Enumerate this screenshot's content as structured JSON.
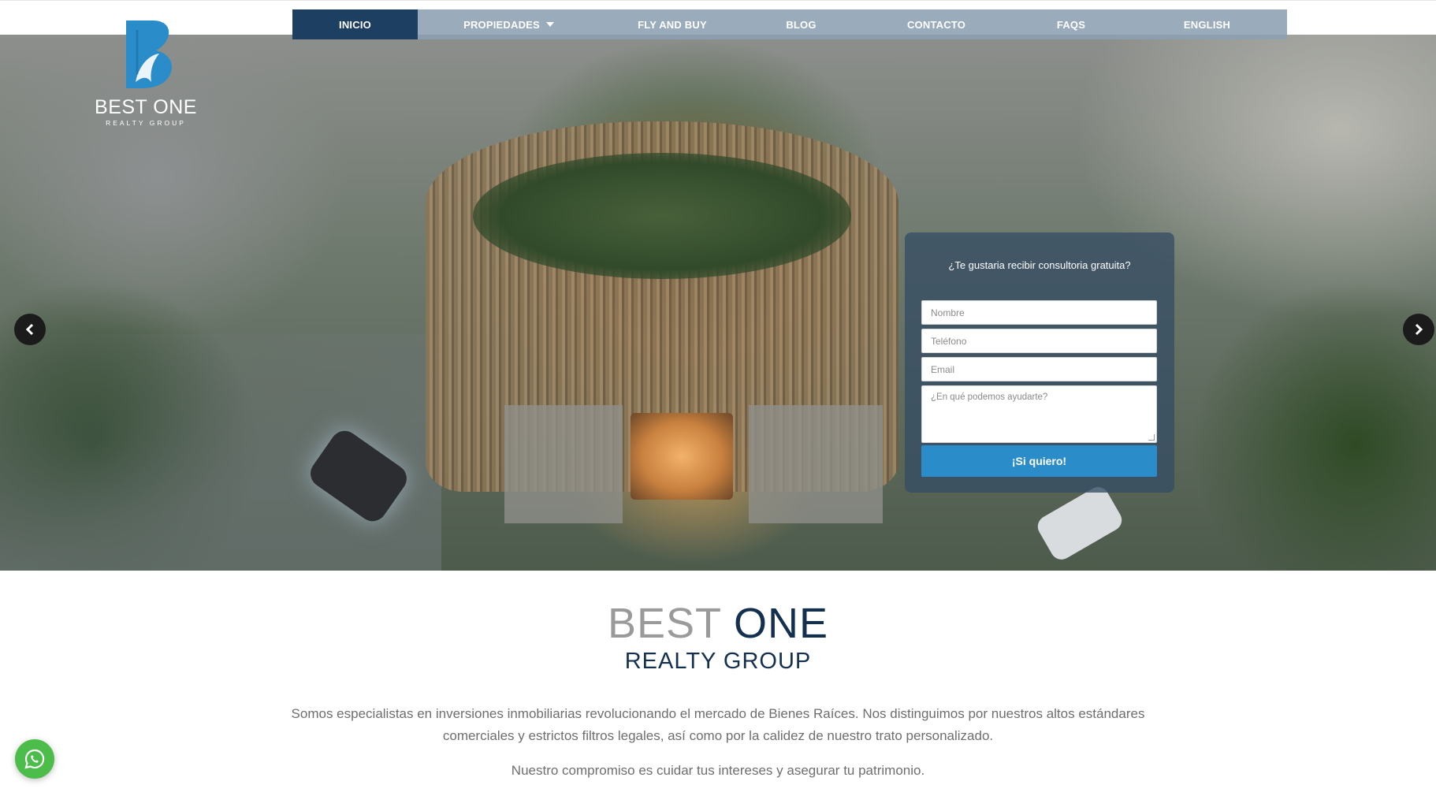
{
  "nav": {
    "items": [
      {
        "label": "INICIO",
        "active": true
      },
      {
        "label": "PROPIEDADES",
        "dropdown": true
      },
      {
        "label": "FLY AND BUY"
      },
      {
        "label": "BLOG"
      },
      {
        "label": "CONTACTO"
      },
      {
        "label": "FAQS"
      },
      {
        "label": "ENGLISH"
      }
    ]
  },
  "logo": {
    "name": "BEST ONE",
    "sub": "REALTY GROUP"
  },
  "form": {
    "question": "¿Te gustaria recibir consultoria gratuita?",
    "name_placeholder": "Nombre",
    "phone_placeholder": "Teléfono",
    "email_placeholder": "Email",
    "message_placeholder": "¿En qué podemos ayudarte?",
    "submit_label": "¡Si quiero!"
  },
  "intro": {
    "brand_best": "BEST",
    "brand_one": "ONE",
    "brand_sub": "REALTY GROUP",
    "paragraph1": "Somos especialistas en inversiones inmobiliarias revolucionando el mercado de Bienes Raíces. Nos distinguimos por nuestros altos estándares comerciales y estrictos filtros legales, así como por la calidez de nuestro trato personalizado.",
    "paragraph2": "Nuestro compromiso es cuidar tus intereses y asegurar tu patrimonio."
  },
  "icons": {
    "prev": "chevron-left-icon",
    "next": "chevron-right-icon",
    "whatsapp": "whatsapp-icon",
    "dropdown": "caret-down-icon"
  },
  "colors": {
    "nav_active": "#1c3f62",
    "nav_bg": "#8ca0b2",
    "submit": "#2a8cc9",
    "brand_dark": "#14304f",
    "whatsapp": "#4cbc4b"
  }
}
